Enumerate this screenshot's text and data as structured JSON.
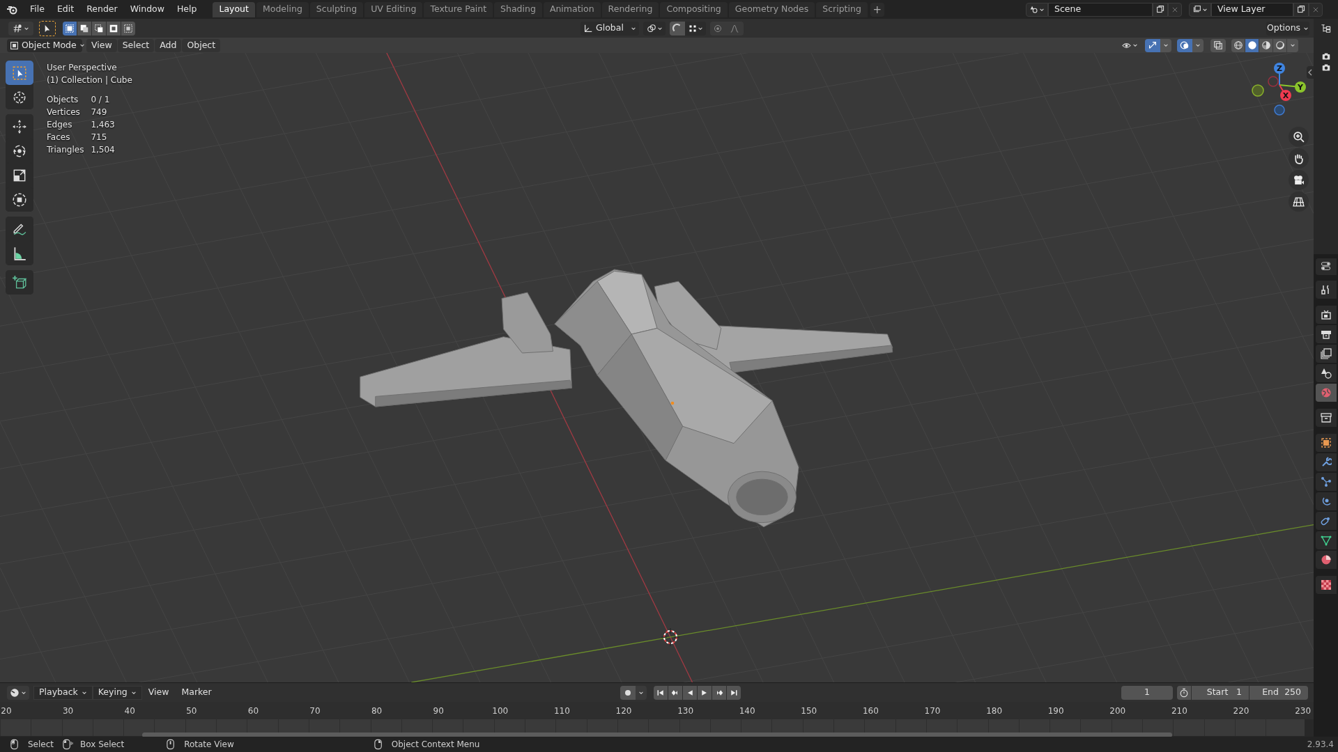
{
  "top_menu": [
    "File",
    "Edit",
    "Render",
    "Window",
    "Help"
  ],
  "workspace_tabs": [
    {
      "label": "Layout",
      "selected": true
    },
    {
      "label": "Modeling",
      "selected": false
    },
    {
      "label": "Sculpting",
      "selected": false
    },
    {
      "label": "UV Editing",
      "selected": false
    },
    {
      "label": "Texture Paint",
      "selected": false
    },
    {
      "label": "Shading",
      "selected": false
    },
    {
      "label": "Animation",
      "selected": false
    },
    {
      "label": "Rendering",
      "selected": false
    },
    {
      "label": "Compositing",
      "selected": false
    },
    {
      "label": "Geometry Nodes",
      "selected": false
    },
    {
      "label": "Scripting",
      "selected": false
    }
  ],
  "add_tab": "+",
  "scene": "Scene",
  "view_layer": "View Layer",
  "tool_header": {
    "selection_modes": [
      {
        "selected": true
      },
      {
        "selected": false
      },
      {
        "selected": false
      },
      {
        "selected": false
      },
      {
        "selected": false
      }
    ],
    "orientation": "Global",
    "options": "Options"
  },
  "viewport_header": {
    "mode": "Object Mode",
    "menus": [
      "View",
      "Select",
      "Add",
      "Object"
    ],
    "gizmos_on": true,
    "overlays_on": true,
    "xray_on": false,
    "shading": [
      {
        "kind": "wireframe",
        "selected": false
      },
      {
        "kind": "solid",
        "selected": true
      },
      {
        "kind": "material",
        "selected": false
      },
      {
        "kind": "rendered",
        "selected": false
      }
    ]
  },
  "viewport": {
    "view_name": "User Perspective",
    "collection": "(1) Collection | Cube",
    "statistics": [
      {
        "label": "Objects",
        "value": "0 / 1"
      },
      {
        "label": "Vertices",
        "value": "749"
      },
      {
        "label": "Edges",
        "value": "1,463"
      },
      {
        "label": "Faces",
        "value": "715"
      },
      {
        "label": "Triangles",
        "value": "1,504"
      }
    ],
    "tool_groups": [
      [
        {
          "kind": "select",
          "selected": true
        },
        {
          "kind": "cursor",
          "selected": false
        }
      ],
      [
        {
          "kind": "move",
          "selected": false
        },
        {
          "kind": "rotate",
          "selected": false
        },
        {
          "kind": "scale",
          "selected": false
        },
        {
          "kind": "transform",
          "selected": false
        }
      ],
      [
        {
          "kind": "annotate",
          "selected": false
        },
        {
          "kind": "measure",
          "selected": false
        }
      ],
      [
        {
          "kind": "add_cube",
          "selected": false
        }
      ]
    ],
    "gizmo_axes": [
      "Z",
      "Y",
      "X"
    ]
  },
  "properties_tabs": [
    {
      "kind": "tool",
      "selected": false
    },
    {
      "kind": "render",
      "selected": false
    },
    {
      "kind": "output",
      "selected": false
    },
    {
      "kind": "view_layer",
      "selected": false
    },
    {
      "kind": "scene",
      "selected": false
    },
    {
      "kind": "world",
      "selected": true
    },
    {
      "kind": "collection",
      "selected": false
    },
    {
      "kind": "object",
      "selected": false
    },
    {
      "kind": "modifiers",
      "selected": false
    },
    {
      "kind": "particles",
      "selected": false
    },
    {
      "kind": "physics",
      "selected": false
    },
    {
      "kind": "constraints",
      "selected": false
    },
    {
      "kind": "data",
      "selected": false
    },
    {
      "kind": "material",
      "selected": false
    },
    {
      "kind": "texture",
      "selected": false
    }
  ],
  "timeline": {
    "menus": [
      {
        "kind": "dropdown",
        "label": "Playback"
      },
      {
        "kind": "dropdown",
        "label": "Keying"
      },
      {
        "kind": "menu",
        "label": "View"
      },
      {
        "kind": "menu",
        "label": "Marker"
      }
    ],
    "current_frame": "1",
    "start_label": "Start",
    "start": "1",
    "end_label": "End",
    "end": "250",
    "ruler": [
      "20",
      "30",
      "40",
      "50",
      "60",
      "70",
      "80",
      "90",
      "100",
      "110",
      "120",
      "130",
      "140",
      "150",
      "160",
      "170",
      "180",
      "190",
      "200",
      "210",
      "220",
      "230"
    ]
  },
  "status_bar": {
    "hints": [
      {
        "kind": "left",
        "label": "Select"
      },
      {
        "kind": "left_drag",
        "label": "Box Select"
      },
      {
        "kind": "middle",
        "label": "Rotate View"
      },
      {
        "kind": "right",
        "label": "Object Context Menu"
      }
    ],
    "version": "2.93.4"
  }
}
